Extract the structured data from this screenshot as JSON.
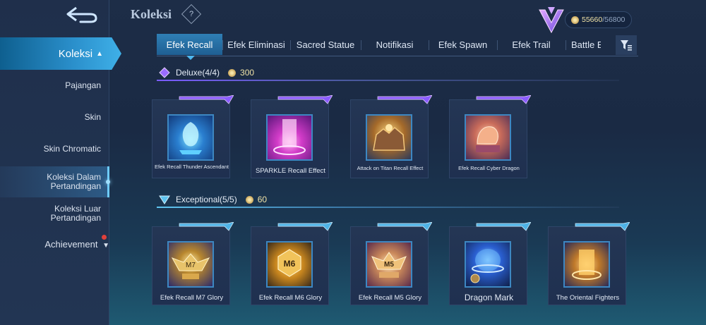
{
  "header": {
    "title": "Koleksi",
    "help_symbol": "?",
    "currency_current": "55660",
    "currency_max": "/56800"
  },
  "sidebar": {
    "main": "Koleksi",
    "items": [
      {
        "label": "Pajangan"
      },
      {
        "label": "Skin"
      },
      {
        "label": "Skin Chromatic"
      },
      {
        "label_line1": "Koleksi Dalam",
        "label_line2": "Pertandingan"
      },
      {
        "label_line1": "Koleksi Luar",
        "label_line2": "Pertandingan"
      },
      {
        "label": "Achievement"
      }
    ]
  },
  "tabs": [
    "Efek Recall",
    "Efek Eliminasi",
    "Sacred Statue",
    "Notifikasi",
    "Efek Spawn",
    "Efek Trail",
    "Battle E"
  ],
  "sections": {
    "deluxe": {
      "title": "Deluxe(4/4)",
      "price": "300",
      "items": [
        {
          "name": "Efek Recall Thunder Ascendant"
        },
        {
          "name": "SPARKLE Recall Effect"
        },
        {
          "name": "Attack on Titan Recall Effect"
        },
        {
          "name": "Efek Recall Cyber Dragon"
        }
      ]
    },
    "exceptional": {
      "title": "Exceptional(5/5)",
      "price": "60",
      "items": [
        {
          "name": "Efek Recall M7 Glory",
          "badge": "M7"
        },
        {
          "name": "Efek Recall M6 Glory",
          "badge": "M6"
        },
        {
          "name": "Efek Recall M5 Glory",
          "badge": "M5"
        },
        {
          "name": "Dragon Mark"
        },
        {
          "name": "The Oriental Fighters"
        }
      ]
    }
  },
  "colors": {
    "accent_blue": "#2f7fb5",
    "deluxe_purple": "#7a5cff",
    "exceptional_blue": "#5fc4f0",
    "gold": "#f0e2a6"
  },
  "icons": [
    "back-arrow-icon",
    "help-icon",
    "coin-icon",
    "rank-emblem-icon",
    "filter-icon",
    "chevron-up-icon",
    "chevron-down-icon",
    "notification-dot-icon"
  ]
}
